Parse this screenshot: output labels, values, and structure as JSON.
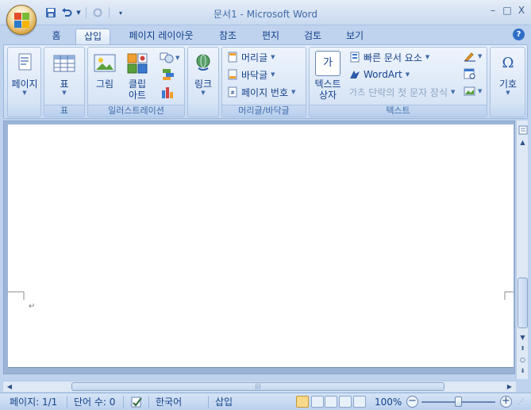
{
  "window": {
    "title": "문서1 - Microsoft Word",
    "controls": [
      "–",
      "□",
      "X"
    ]
  },
  "quick_access": {
    "save_icon": "save-icon",
    "undo_icon": "undo-icon",
    "redo_icon": "redo-icon",
    "customize_icon": "chevron-down-icon"
  },
  "tabs": [
    {
      "label": "홈"
    },
    {
      "label": "삽입"
    },
    {
      "label": "페이지 레이아웃"
    },
    {
      "label": "참조"
    },
    {
      "label": "편지"
    },
    {
      "label": "검토"
    },
    {
      "label": "보기"
    }
  ],
  "active_tab": "삽입",
  "ribbon": {
    "pages": {
      "button": "페이지"
    },
    "table": {
      "button": "표",
      "group": "표"
    },
    "illustrations": {
      "picture": "그림",
      "clip_line1": "클립",
      "clip_line2": "아트",
      "group": "일러스트레이션"
    },
    "links": {
      "button": "링크"
    },
    "header_footer": {
      "header": "머리글",
      "footer": "바닥글",
      "page_number": "페이지 번호",
      "group": "머리글/바닥글"
    },
    "text": {
      "textbox_line1": "텍스트",
      "textbox_line2": "상자",
      "quick_parts": "빠른 문서 요소",
      "wordart": "WordArt",
      "dropcap": "단락의 첫 문자 장식",
      "textbox_icon_text": "가",
      "dropcap_icon_text": "가츠",
      "group": "텍스트"
    },
    "symbols": {
      "button": "기호",
      "icon_text": "Ω"
    }
  },
  "help_icon_text": "?",
  "pilcrow": "↵",
  "hscroll_grip": "|||",
  "status": {
    "page": "페이지: 1/1",
    "words": "단어 수: 0",
    "language": "한국어",
    "mode": "삽입",
    "zoom": "100%",
    "zoom_minus": "−",
    "zoom_plus": "+",
    "zoom_level": 1.0
  },
  "colors": {
    "ribbon_bg": "#d2e1f4",
    "text": "#15428b",
    "accent": "#2f6ec6"
  }
}
